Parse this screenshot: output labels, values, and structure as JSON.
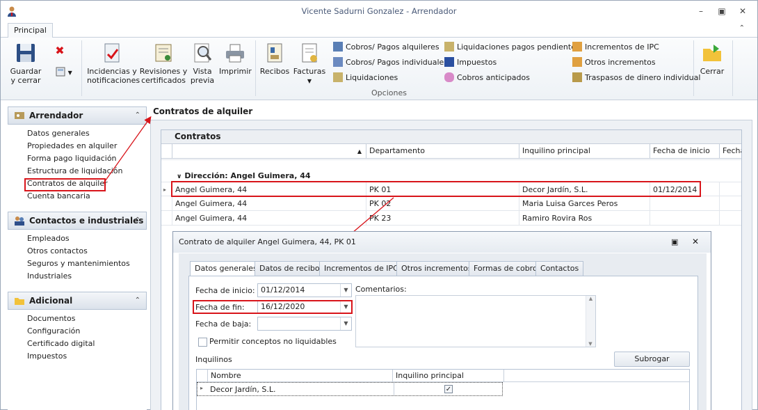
{
  "window": {
    "title": "Vicente Sadurni Gonzalez - Arrendador"
  },
  "ribbon_tab": "Principal",
  "ribbon": {
    "guardar": "Guardar\ny cerrar",
    "incidencias": "Incidencias y\nnotificaciones",
    "revisiones": "Revisiones y\ncertificados",
    "vista": "Vista\nprevia",
    "imprimir": "Imprimir",
    "recibos": "Recibos",
    "facturas": "Facturas",
    "small_items": [
      "Cobros/ Pagos alquileres",
      "Cobros/ Pagos individuales",
      "Liquidaciones",
      "Liquidaciones pagos pendientes",
      "Impuestos",
      "Cobros anticipados",
      "Incrementos de IPC",
      "Otros incrementos",
      "Traspasos de dinero individual"
    ],
    "group_label": "Opciones",
    "cerrar": "Cerrar"
  },
  "sidebar": {
    "sections": [
      {
        "title": "Arrendador",
        "items": [
          "Datos generales",
          "Propiedades en alquiler",
          "Forma pago liquidación",
          "Estructura de liquidación",
          "Contratos de alquiler",
          "Cuenta bancaria"
        ]
      },
      {
        "title": "Contactos e industriales",
        "items": [
          "Empleados",
          "Otros contactos",
          "Seguros y mantenimientos",
          "Industriales"
        ]
      },
      {
        "title": "Adicional",
        "items": [
          "Documentos",
          "Configuración",
          "Certificado digital",
          "Impuestos"
        ]
      }
    ]
  },
  "main": {
    "title": "Contratos de alquiler",
    "grid_title": "Contratos",
    "columns": [
      "",
      "Departamento",
      "Inquilino principal",
      "Fecha de inicio",
      "Fecha"
    ],
    "group": "Dirección: Angel Guimera, 44",
    "rows": [
      [
        "Angel Guimera, 44",
        "PK 01",
        "Decor Jardín, S.L.",
        "01/12/2014"
      ],
      [
        "Angel Guimera, 44",
        "PK 02",
        "Maria Luisa Garces Peros",
        ""
      ],
      [
        "Angel Guimera, 44",
        "PK 23",
        "Ramiro Rovira Ros",
        ""
      ]
    ]
  },
  "dialog": {
    "title": "Contrato de alquiler Angel Guimera, 44, PK 01",
    "tabs": [
      "Datos generales",
      "Datos de recibo",
      "Incrementos de IPC",
      "Otros incrementos",
      "Formas de cobro",
      "Contactos"
    ],
    "fecha_inicio_label": "Fecha de inicio:",
    "fecha_inicio": "01/12/2014",
    "fecha_fin_label": "Fecha de fin:",
    "fecha_fin": "16/12/2020",
    "fecha_baja_label": "Fecha de baja:",
    "fecha_baja": "",
    "comentarios_label": "Comentarios:",
    "permitir_label": "Permitir conceptos no liquidables",
    "inquilinos_label": "Inquilinos",
    "subrogar": "Subrogar",
    "inq_columns": [
      "Nombre",
      "Inquilino principal"
    ],
    "inq_rows": [
      {
        "nombre": "Decor Jardín, S.L.",
        "principal": true
      }
    ]
  }
}
